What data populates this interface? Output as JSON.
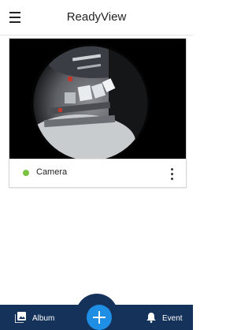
{
  "header": {
    "title": "ReadyView",
    "menu_icon": "hamburger-menu-icon"
  },
  "camera_card": {
    "name": "Camera",
    "status_color": "#7cc242",
    "more_icon": "more-vertical-icon",
    "preview": "fisheye-camera-feed"
  },
  "bottom_nav": {
    "album_label": "Album",
    "album_icon": "photo-album-icon",
    "add_icon": "plus-icon",
    "event_label": "Event",
    "event_icon": "bell-icon",
    "bar_color": "#15325a",
    "fab_color": "#1f8fe6"
  }
}
